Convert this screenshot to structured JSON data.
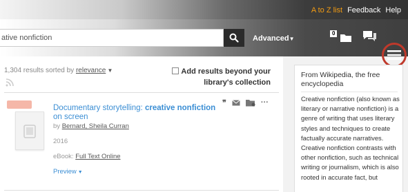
{
  "header": {
    "links": {
      "atoz": "A to Z list",
      "feedback": "Feedback",
      "help": "Help"
    },
    "accent_color": "#f39c12"
  },
  "search": {
    "query": "ative nonfiction",
    "advanced_label": "Advanced",
    "folder_count": "0",
    "icons": [
      "search-icon",
      "folder-icon",
      "chat-icon",
      "hamburger-menu-icon"
    ],
    "highlight_color": "#c0392b"
  },
  "results": {
    "count_text": "1,304 results sorted by",
    "sort_value": "relevance",
    "add_results_label": "Add results beyond your library's collection"
  },
  "record": {
    "title_plain": "Documentary storytelling: ",
    "title_highlight": "creative nonfiction",
    "title_after": " on screen",
    "by_label": "by",
    "author": "Bernard, Sheila Curran",
    "year": "2016",
    "ebook_label": "eBook:",
    "full_text": "Full Text Online",
    "preview_label": "Preview",
    "actions": [
      "cite-icon",
      "email-icon",
      "save-folder-icon",
      "more-icon"
    ]
  },
  "wiki": {
    "title": "From Wikipedia, the free encyclopedia",
    "body": "Creative nonfiction (also known as literary or narrative nonfiction) is a genre of writing that uses literary styles and techniques to create factually accurate narratives. Creative nonfiction contrasts with other nonfiction, such as technical writing or journalism, which is also rooted in accurate fact, but"
  }
}
